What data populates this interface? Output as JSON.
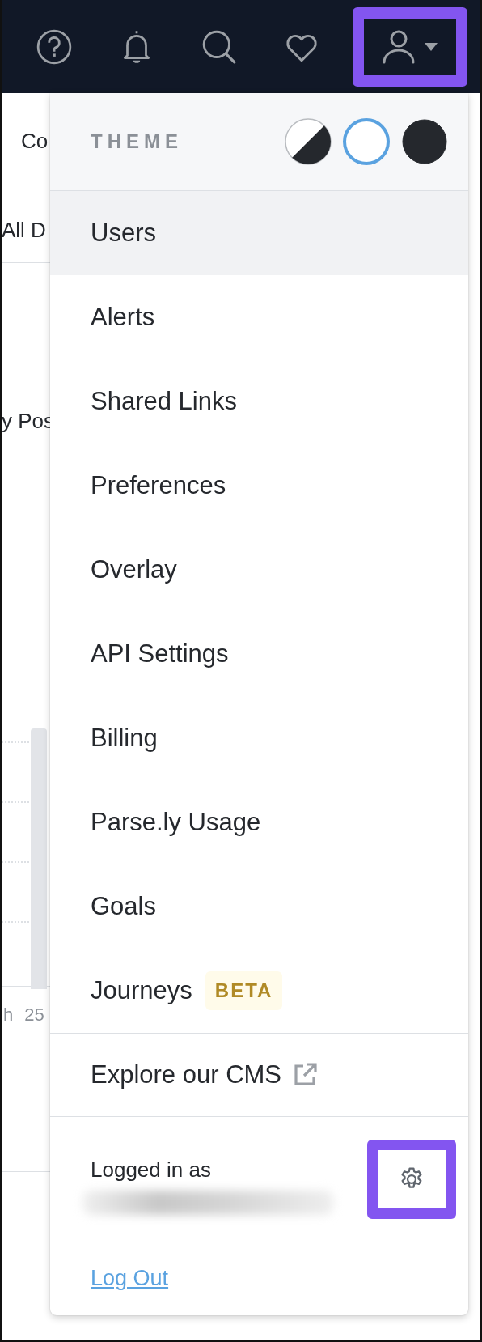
{
  "top_bar": {
    "icons": [
      {
        "kind": "help"
      },
      {
        "kind": "bell"
      },
      {
        "kind": "search"
      },
      {
        "kind": "heart"
      }
    ],
    "user_button": {
      "highlighted": true
    }
  },
  "background": {
    "texts": [
      "Co",
      "All D",
      "y Pos",
      "h",
      "25"
    ]
  },
  "menu": {
    "theme": {
      "label": "THEME",
      "options": [
        {
          "kind": "auto",
          "selected": false
        },
        {
          "kind": "light",
          "selected": true
        },
        {
          "kind": "dark",
          "selected": false
        }
      ]
    },
    "items": [
      {
        "label": "Users",
        "selected": true
      },
      {
        "label": "Alerts",
        "selected": false
      },
      {
        "label": "Shared Links",
        "selected": false
      },
      {
        "label": "Preferences",
        "selected": false
      },
      {
        "label": "Overlay",
        "selected": false
      },
      {
        "label": "API Settings",
        "selected": false
      },
      {
        "label": "Billing",
        "selected": false
      },
      {
        "label": "Parse.ly Usage",
        "selected": false
      },
      {
        "label": "Goals",
        "selected": false
      },
      {
        "label": "Journeys",
        "selected": false,
        "badge": "BETA"
      }
    ],
    "external_link": {
      "label": "Explore our CMS"
    },
    "account": {
      "label": "Logged in as",
      "settings_highlighted": true,
      "logout": "Log Out"
    }
  }
}
